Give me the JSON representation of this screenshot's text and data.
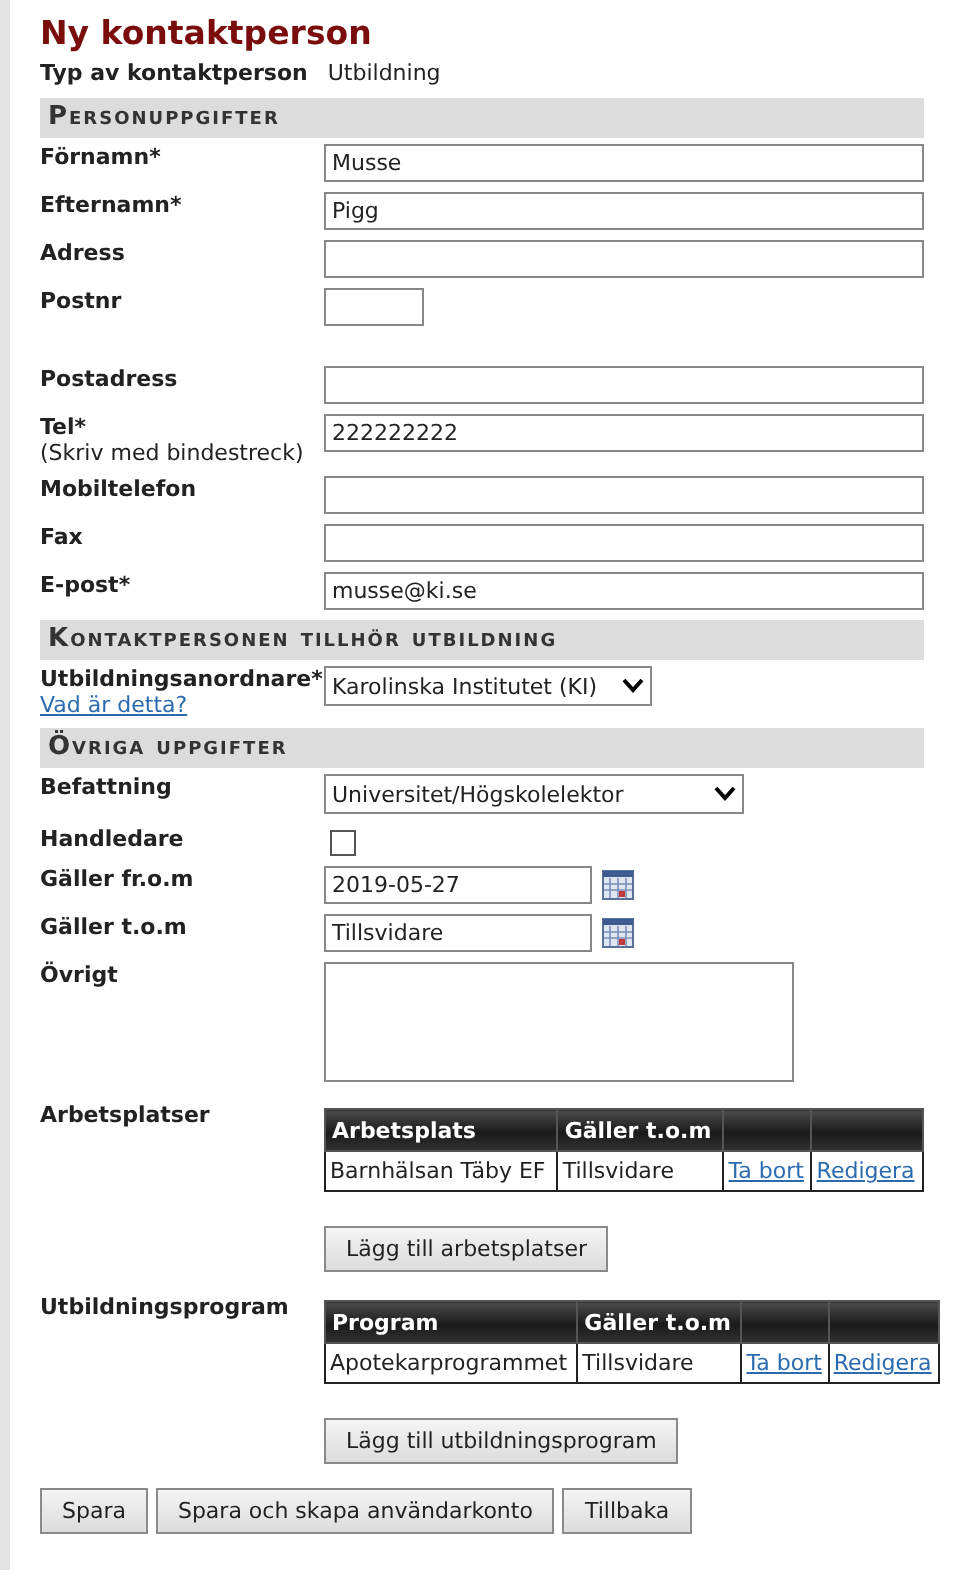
{
  "title": "Ny kontaktperson",
  "type_row": {
    "label": "Typ av kontaktperson",
    "value": "Utbildning"
  },
  "sections": [
    {
      "heading": "Personuppgifter",
      "rows": [
        {
          "kind": "text",
          "label": "Förnamn*",
          "value": "Musse"
        },
        {
          "kind": "text",
          "label": "Efternamn*",
          "value": "Pigg"
        },
        {
          "kind": "text",
          "label": "Adress"
        },
        {
          "kind": "short",
          "label": "Postnr"
        },
        {
          "kind": "text",
          "label": "Postadress"
        },
        {
          "kind": "text",
          "label": "Tel*",
          "hint": "(Skriv med bindestreck)",
          "value": "222222222"
        },
        {
          "kind": "text",
          "label": "Mobiltelefon"
        },
        {
          "kind": "text",
          "label": "Fax"
        },
        {
          "kind": "text",
          "label": "E-post*",
          "value": "musse@ki.se"
        }
      ]
    },
    {
      "heading": "Kontaktpersonen tillhör utbildning",
      "rows": [
        {
          "kind": "select",
          "label": "Utbildningsanordnare*",
          "link": "Vad är detta?",
          "value": "Karolinska Institutet (KI)"
        }
      ]
    },
    {
      "heading": "Övriga uppgifter",
      "rows": [
        {
          "kind": "select",
          "label": "Befattning",
          "value": "Universitet/Högskolelektor",
          "wide": true
        },
        {
          "kind": "checkbox",
          "label": "Handledare",
          "checked": false
        },
        {
          "kind": "date",
          "label": "Gäller fr.o.m",
          "value": "2019-05-27"
        },
        {
          "kind": "date",
          "label": "Gäller t.o.m",
          "value": "Tillsvidare"
        },
        {
          "kind": "textarea",
          "label": "Övrigt"
        },
        {
          "kind": "table",
          "label": "Arbetsplatser",
          "columns": [
            "Arbetsplats",
            "Gäller t.o.m"
          ],
          "rows": [
            [
              "Barnhälsan Täby EF",
              "Tillsvidare",
              "Ta bort",
              "Redigera"
            ]
          ],
          "button": "Lägg till arbetsplatser"
        },
        {
          "kind": "table",
          "label": "Utbildningsprogram",
          "columns": [
            "Program",
            "Gäller t.o.m"
          ],
          "rows": [
            [
              "Apotekarprogrammet",
              "Tillsvidare",
              "Ta bort",
              "Redigera"
            ]
          ],
          "button": "Lägg till utbildningsprogram"
        }
      ]
    }
  ],
  "buttons": [
    "Spara",
    "Spara och skapa användarkonto",
    "Tillbaka"
  ]
}
